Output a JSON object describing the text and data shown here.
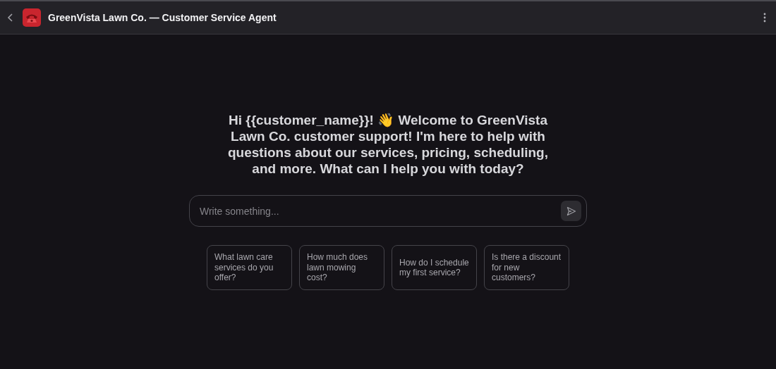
{
  "header": {
    "title": "GreenVista Lawn Co. — Customer Service Agent"
  },
  "greeting": "Hi {{customer_name}}! 👋 Welcome to GreenVista Lawn Co. customer support! I'm here to help with questions about our services, pricing, scheduling, and more. What can I help you with today?",
  "composer": {
    "placeholder": "Write something..."
  },
  "suggestions": [
    "What lawn care services do you offer?",
    "How much does lawn mowing cost?",
    "How do I schedule my first service?",
    "Is there a discount for new customers?"
  ]
}
